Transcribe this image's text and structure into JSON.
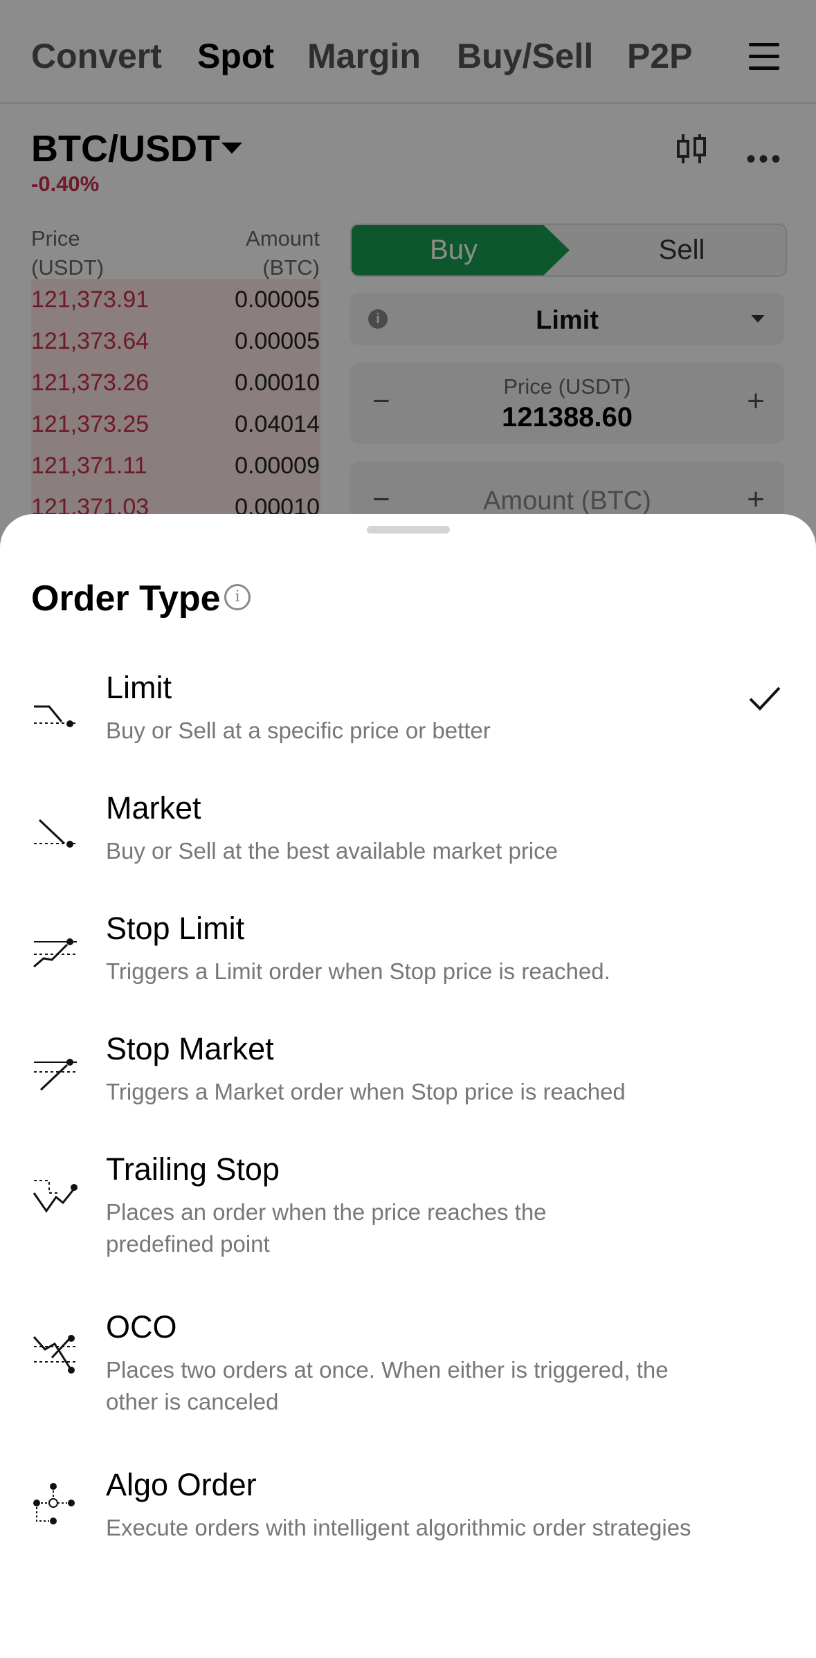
{
  "nav": {
    "tabs": [
      "Convert",
      "Spot",
      "Margin",
      "Buy/Sell",
      "P2P"
    ],
    "active_tab": "Spot"
  },
  "market": {
    "pair": "BTC/USDT",
    "change": "-0.40%"
  },
  "orderbook": {
    "price_header_line1": "Price",
    "price_header_line2": "(USDT)",
    "amount_header_line1": "Amount",
    "amount_header_line2": "(BTC)",
    "rows": [
      {
        "price": "121,373.91",
        "amount": "0.00005"
      },
      {
        "price": "121,373.64",
        "amount": "0.00005"
      },
      {
        "price": "121,373.26",
        "amount": "0.00010"
      },
      {
        "price": "121,373.25",
        "amount": "0.04014"
      },
      {
        "price": "121,371.11",
        "amount": "0.00009"
      },
      {
        "price": "121,371.03",
        "amount": "0.00010"
      }
    ]
  },
  "trade_form": {
    "buy_label": "Buy",
    "sell_label": "Sell",
    "order_type_value": "Limit",
    "price_label": "Price (USDT)",
    "price_value": "121388.60",
    "amount_placeholder": "Amount (BTC)",
    "minus": "−",
    "plus": "+",
    "info_glyph": "i"
  },
  "sheet": {
    "title": "Order Type",
    "title_info_glyph": "i",
    "options": [
      {
        "title": "Limit",
        "desc": "Buy or Sell at a specific price or better",
        "selected": true,
        "icon": "limit-icon"
      },
      {
        "title": "Market",
        "desc": "Buy or Sell at the best available market price",
        "selected": false,
        "icon": "market-icon"
      },
      {
        "title": "Stop Limit",
        "desc": "Triggers a Limit order when Stop price is reached.",
        "selected": false,
        "icon": "stop-limit-icon"
      },
      {
        "title": "Stop Market",
        "desc": "Triggers a Market order when Stop price is reached",
        "selected": false,
        "icon": "stop-market-icon"
      },
      {
        "title": "Trailing Stop",
        "desc_line1": "Places an order when the price reaches the",
        "desc_line2": "predefined point",
        "selected": false,
        "icon": "trailing-stop-icon"
      },
      {
        "title": "OCO",
        "desc_line1": "Places two orders at once. When either is triggered, the",
        "desc_line2": "other is canceled",
        "selected": false,
        "icon": "oco-icon"
      },
      {
        "title": "Algo Order",
        "desc": "Execute orders with intelligent algorithmic order strategies",
        "selected": false,
        "icon": "algo-order-icon"
      }
    ]
  },
  "colors": {
    "buy_green": "#1a9e52",
    "ask_red": "#c9304a",
    "scrim": "rgba(0,0,0,0.45)"
  }
}
